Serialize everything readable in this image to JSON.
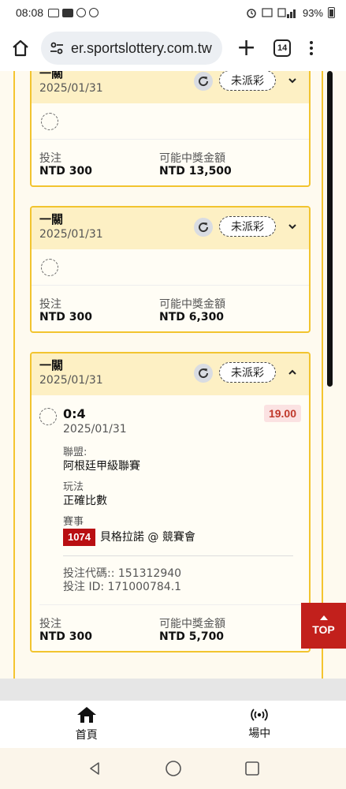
{
  "status_bar": {
    "time": "08:08",
    "battery": "93%"
  },
  "browser": {
    "url": "er.sportslottery.com.tw",
    "tab_count": "14"
  },
  "cards": [
    {
      "title": "一關",
      "date": "2025/01/31",
      "status": "未派彩",
      "expanded": false,
      "stake_label": "投注",
      "stake_value": "NTD 300",
      "payout_label": "可能中獎金額",
      "payout_value": "NTD 13,500"
    },
    {
      "title": "一關",
      "date": "2025/01/31",
      "status": "未派彩",
      "expanded": false,
      "stake_label": "投注",
      "stake_value": "NTD 300",
      "payout_label": "可能中獎金額",
      "payout_value": "NTD 6,300"
    },
    {
      "title": "一關",
      "date": "2025/01/31",
      "status": "未派彩",
      "expanded": true,
      "selection": {
        "score": "0:4",
        "date": "2025/01/31",
        "odds": "19.00",
        "league_label": "聯盟:",
        "league_value": "阿根廷甲級聯賽",
        "market_label": "玩法",
        "market_value": "正確比數",
        "event_label": "賽事",
        "event_number": "1074",
        "event_name": "貝格拉諾 @ 競賽會"
      },
      "bet_code": "投注代碼:: 151312940",
      "bet_id": "投注 ID: 171000784.1",
      "stake_label": "投注",
      "stake_value": "NTD 300",
      "payout_label": "可能中獎金額",
      "payout_value": "NTD 5,700"
    }
  ],
  "top_button": "TOP",
  "bottom_nav": [
    {
      "label": "首頁",
      "icon": "home-icon"
    },
    {
      "label": "場中",
      "icon": "live-broadcast-icon"
    }
  ],
  "colors": {
    "accent_yellow": "#f2c42f",
    "card_header": "#fdf0c4",
    "brand_red": "#c2201c",
    "odds_red": "#c0392b"
  }
}
